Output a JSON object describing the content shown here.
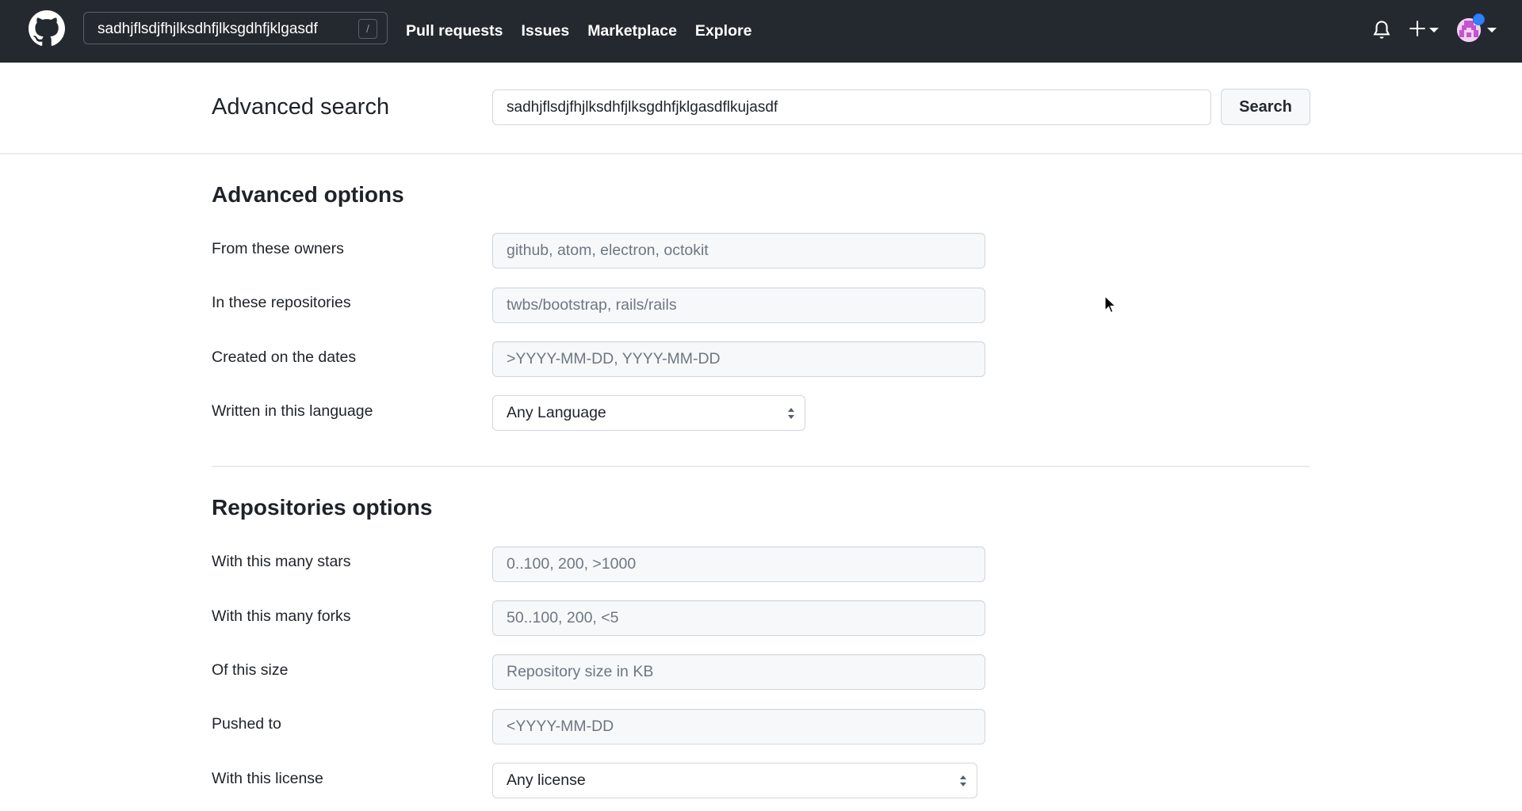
{
  "header": {
    "search_value": "sadhjflsdjfhjlksdhfjlksgdhfjklgasdf",
    "slash_key": "/",
    "nav": [
      "Pull requests",
      "Issues",
      "Marketplace",
      "Explore"
    ],
    "icons": [
      "github-logo-icon",
      "bell-icon",
      "plus-icon",
      "avatar"
    ],
    "notification_dot_color": "#2f81f7"
  },
  "search": {
    "title": "Advanced search",
    "query": "sadhjflsdjfhjlksdhfjlksgdhfjklgasdflkujasdf",
    "button_label": "Search"
  },
  "advanced_options": {
    "title": "Advanced options",
    "rows": [
      {
        "label": "From these owners",
        "placeholder": "github, atom, electron, octokit"
      },
      {
        "label": "In these repositories",
        "placeholder": "twbs/bootstrap, rails/rails"
      },
      {
        "label": "Created on the dates",
        "placeholder": ">YYYY-MM-DD, YYYY-MM-DD"
      },
      {
        "label": "Written in this language",
        "selected": "Any Language"
      }
    ]
  },
  "repositories_options": {
    "title": "Repositories options",
    "rows": [
      {
        "label": "With this many stars",
        "placeholder": "0..100, 200, >1000"
      },
      {
        "label": "With this many forks",
        "placeholder": "50..100, 200, <5"
      },
      {
        "label": "Of this size",
        "placeholder": "Repository size in KB"
      },
      {
        "label": "Pushed to",
        "placeholder": "<YYYY-MM-DD"
      },
      {
        "label": "With this license",
        "selected": "Any license"
      }
    ]
  }
}
